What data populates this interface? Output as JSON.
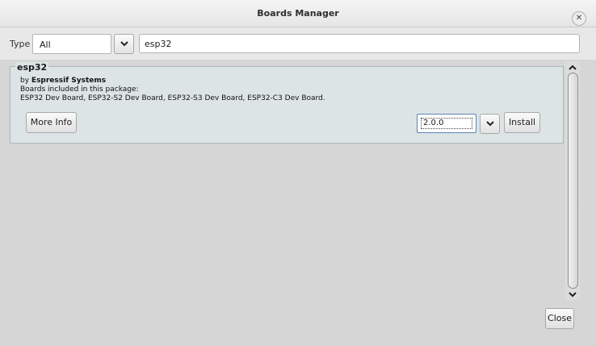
{
  "window": {
    "title": "Boards Manager"
  },
  "filter": {
    "type_label": "Type",
    "type_value": "All",
    "search_value": "esp32"
  },
  "boards": [
    {
      "name": "esp32",
      "by_prefix": "by",
      "author": "Espressif Systems",
      "included_label": "Boards included in this package:",
      "boards_list": "ESP32 Dev Board, ESP32-S2 Dev Board, ESP32-S3 Dev Board, ESP32-C3 Dev Board.",
      "more_info_label": "More Info",
      "version": "2.0.0",
      "install_label": "Install"
    }
  ],
  "footer": {
    "close_label": "Close"
  },
  "icons": {
    "window_close": "close-icon",
    "dropdown": "chevron-down-icon",
    "scroll_up": "chevron-up-icon",
    "scroll_down": "chevron-down-icon"
  },
  "colors": {
    "card_background": "#dde4e6",
    "focus_border": "#5c84b4"
  }
}
